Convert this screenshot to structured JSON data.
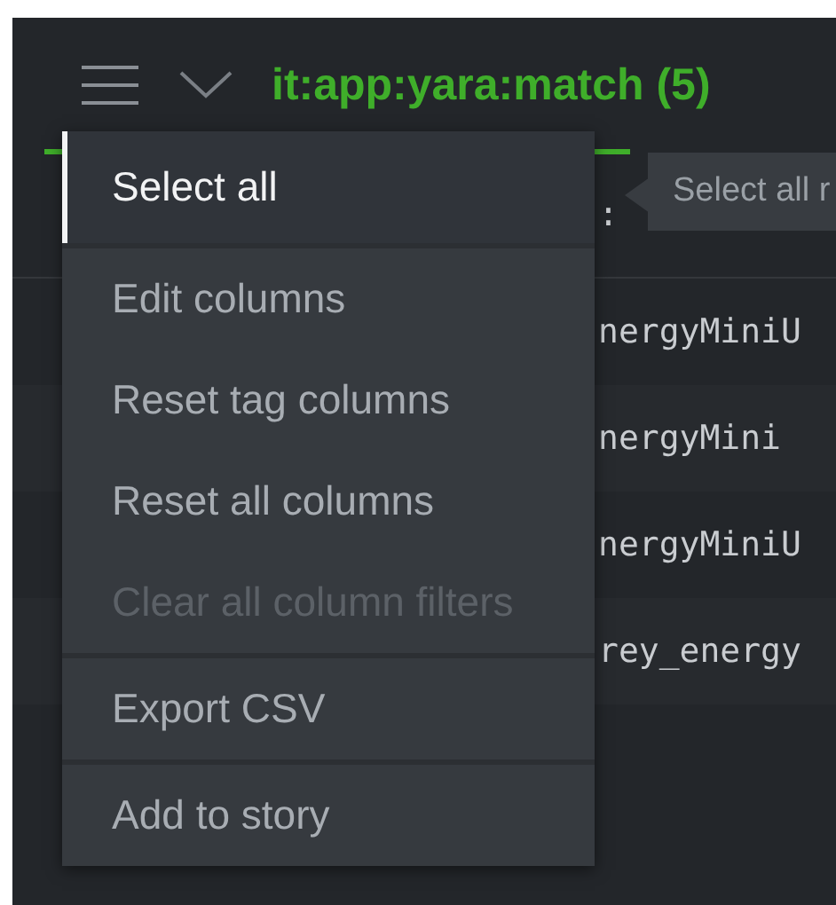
{
  "header": {
    "title": "it:app:yara:match (5)"
  },
  "table": {
    "header_cell": ":",
    "rows": [
      {
        "column_2": "nergyMiniU"
      },
      {
        "column_2": "nergyMini"
      },
      {
        "column_2": "nergyMiniU"
      },
      {
        "column_2": "rey_energy"
      }
    ]
  },
  "tooltip": {
    "text": "Select all r"
  },
  "menu": {
    "groups": [
      [
        {
          "label": "Select all",
          "selected": true,
          "disabled": false
        }
      ],
      [
        {
          "label": "Edit columns",
          "selected": false,
          "disabled": false
        },
        {
          "label": "Reset tag columns",
          "selected": false,
          "disabled": false
        },
        {
          "label": "Reset all columns",
          "selected": false,
          "disabled": false
        },
        {
          "label": "Clear all column filters",
          "selected": false,
          "disabled": true
        }
      ],
      [
        {
          "label": "Export CSV",
          "selected": false,
          "disabled": false
        }
      ],
      [
        {
          "label": "Add to story",
          "selected": false,
          "disabled": false
        }
      ]
    ]
  }
}
